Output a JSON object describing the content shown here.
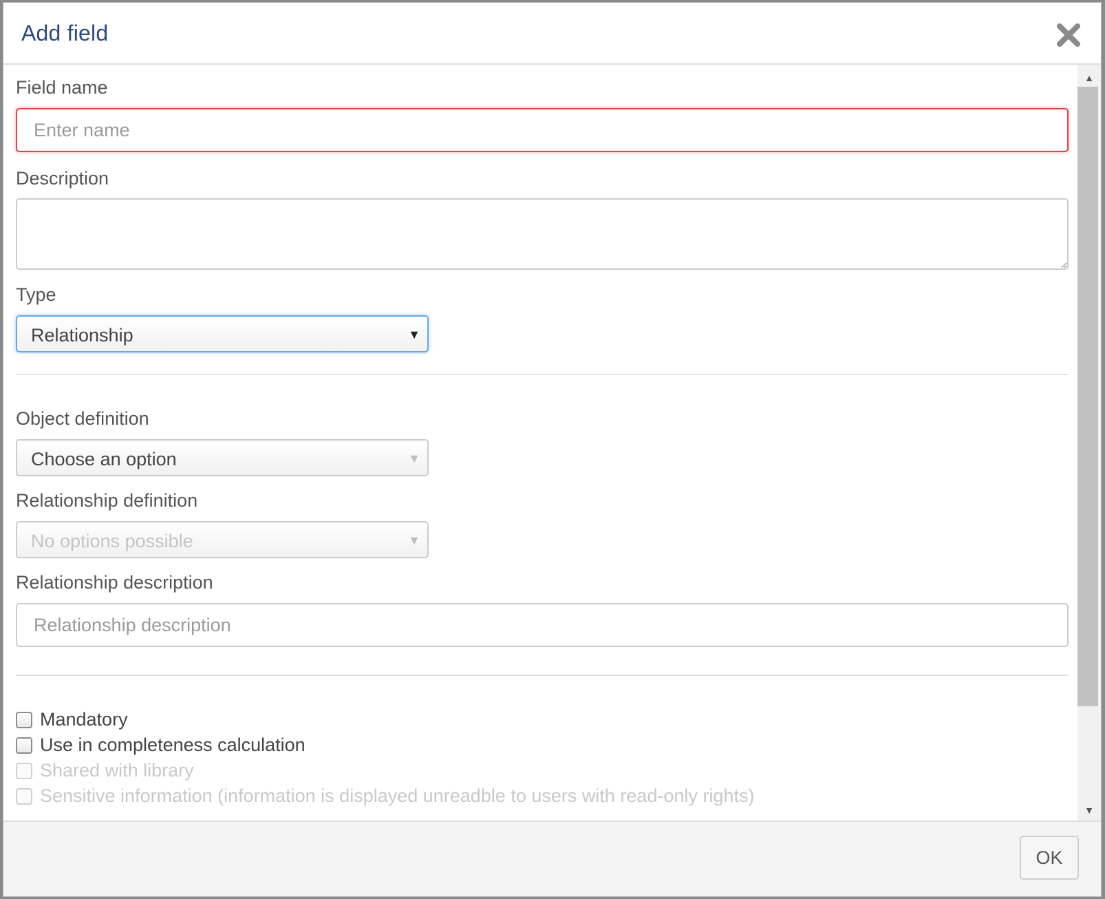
{
  "dialog": {
    "title": "Add field",
    "close_icon": "close-icon"
  },
  "form": {
    "field_name": {
      "label": "Field name",
      "placeholder": "Enter name",
      "value": ""
    },
    "description": {
      "label": "Description",
      "value": ""
    },
    "type": {
      "label": "Type",
      "selected": "Relationship",
      "arrow_icon": "triangle-down-icon"
    },
    "object_definition": {
      "label": "Object definition",
      "selected": "Choose an option"
    },
    "relationship_definition": {
      "label": "Relationship definition",
      "selected": "No options possible",
      "disabled": true
    },
    "relationship_description": {
      "label": "Relationship description",
      "placeholder": "Relationship description",
      "value": ""
    },
    "checkboxes": {
      "mandatory": "Mandatory",
      "completeness": "Use in completeness calculation",
      "shared": "Shared with library",
      "sensitive": "Sensitive information (information is displayed unreadble to users with read-only rights)"
    }
  },
  "footer": {
    "ok_label": "OK"
  },
  "colors": {
    "title": "#2c4a7c",
    "invalid_border": "#e0454e",
    "focus_border": "#6aa8e6"
  }
}
